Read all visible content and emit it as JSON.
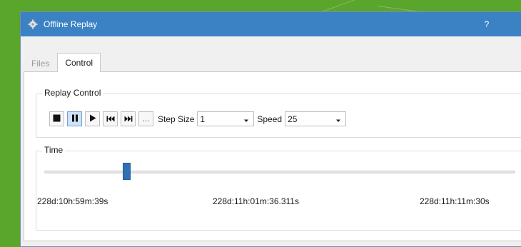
{
  "window": {
    "title": "Offline Replay",
    "help_glyph": "?",
    "close_glyph": "×",
    "titlebar_color": "#3b82c4"
  },
  "tabs": [
    {
      "label": "Files",
      "active": false
    },
    {
      "label": "Control",
      "active": true
    }
  ],
  "replay_control": {
    "title": "Replay Control",
    "buttons": [
      {
        "name": "stop-button",
        "icon": "stop-icon"
      },
      {
        "name": "pause-button",
        "icon": "pause-icon",
        "pressed": true
      },
      {
        "name": "play-button",
        "icon": "play-icon"
      },
      {
        "name": "skip-back-button",
        "icon": "skip-to-start-icon"
      },
      {
        "name": "fast-forward-button",
        "icon": "fast-forward-icon"
      },
      {
        "name": "more-button",
        "label": "..."
      }
    ],
    "step_size_label": "Step Size",
    "step_size_value": "1",
    "speed_label": "Speed",
    "speed_value": "25"
  },
  "time": {
    "title": "Time",
    "position_fraction": 0.17,
    "start": "228d:10h:59m:39s",
    "current": "228d:11h:01m:36.311s",
    "end": "228d:11h:11m:30s"
  },
  "colors": {
    "background": "#5aa52c",
    "slider_handle": "#2f6fb5",
    "pressed_button": "#cfe3f7"
  }
}
